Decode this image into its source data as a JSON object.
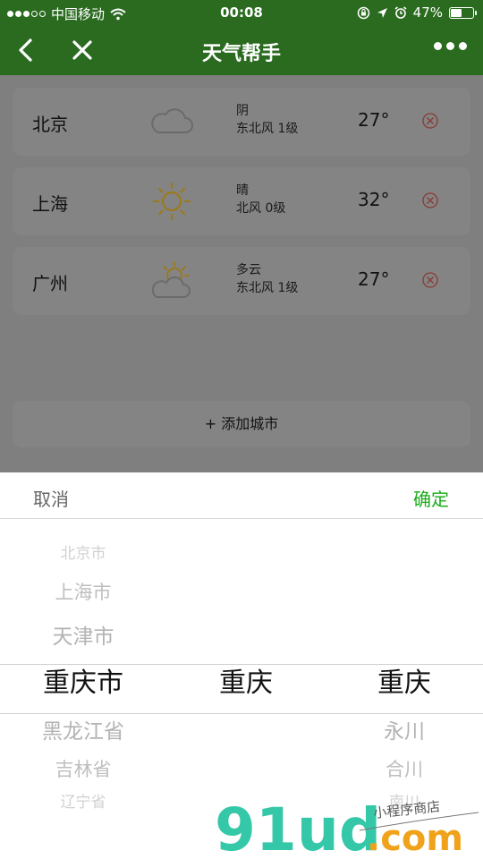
{
  "status_bar": {
    "carrier": "中国移动",
    "time": "00:08",
    "battery_percent": "47%",
    "battery_level": 0.47,
    "icons": [
      "signal-dots-icon",
      "wifi-icon",
      "orientation-lock-icon",
      "location-arrow-icon",
      "alarm-icon",
      "battery-icon"
    ]
  },
  "nav": {
    "title": "天气帮手",
    "back_icon": "chevron-left-icon",
    "close_icon": "close-icon",
    "more_icon": "more-dots-icon"
  },
  "colors": {
    "nav_bg": "#2a6b20",
    "overlay": "#7f7f7f",
    "card": "#848484",
    "confirm": "#1aad19",
    "sun": "#d9a112",
    "delete": "#c0392b"
  },
  "cities": [
    {
      "city": "北京",
      "condition": "阴",
      "wind": "东北风 1级",
      "temperature": "27°",
      "icon": "cloudy-icon"
    },
    {
      "city": "上海",
      "condition": "晴",
      "wind": "北风 0级",
      "temperature": "32°",
      "icon": "sunny-icon"
    },
    {
      "city": "广州",
      "condition": "多云",
      "wind": "东北风 1级",
      "temperature": "27°",
      "icon": "partly-cloudy-icon"
    }
  ],
  "add_city": {
    "label": "+ 添加城市"
  },
  "picker": {
    "cancel": "取消",
    "confirm": "确定",
    "province": {
      "above": [
        "北京市",
        "上海市",
        "天津市"
      ],
      "selected": "重庆市",
      "below": [
        "黑龙江省",
        "吉林省",
        "辽宁省"
      ]
    },
    "city": {
      "above": [],
      "selected": "重庆",
      "below": []
    },
    "district": {
      "above": [],
      "selected": "重庆",
      "below": [
        "永川",
        "合川",
        "南川"
      ]
    }
  },
  "watermark": {
    "logo": "91ud",
    "domain": ".com",
    "tagline": "小程序商店"
  }
}
